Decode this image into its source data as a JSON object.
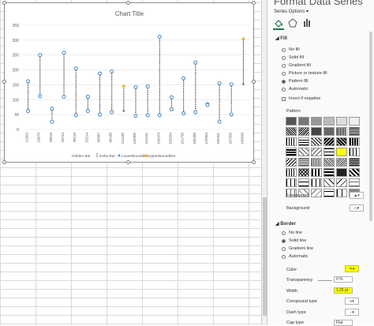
{
  "pane": {
    "title": "Format Data Series",
    "series_options_label": "Series Options",
    "fill_section": "Fill",
    "fill_options": [
      "No fill",
      "Solid fill",
      "Gradient fill",
      "Picture or texture fill",
      "Pattern fill",
      "Automatic"
    ],
    "fill_selected": 4,
    "invert_label": "Invert if negative",
    "pattern_label": "Pattern",
    "foreground_label": "Foreground",
    "background_label": "Background",
    "border_section": "Border",
    "border_options": [
      "No line",
      "Solid line",
      "Gradient line",
      "Automatic"
    ],
    "border_selected": 1,
    "color_label": "Color",
    "transparency_label": "Transparency",
    "transparency_value": "0 %",
    "width_label": "Width",
    "width_value": "1,25 pt",
    "compound_label": "Compound type",
    "dash_label": "Dash type",
    "cap_label": "Cap type",
    "cap_value": "Flat"
  },
  "colors": {
    "highlight": "#ffff00",
    "marker_blue": "#5b9bd5",
    "marker_orange": "#f4b400",
    "accent": "#1f7a4a"
  },
  "chart_data": {
    "type": "line",
    "title": "Chart Title",
    "ylim": [
      0,
      350
    ],
    "yticks": [
      0,
      50,
      100,
      150,
      200,
      250,
      300,
      350
    ],
    "categories": [
      "12963",
      "18679",
      "29010",
      "29724",
      "30210",
      "53214",
      "56587",
      "66188",
      "111440",
      "132305",
      "134111",
      "134474",
      "155334",
      "161790",
      "166288",
      "176963",
      "196201",
      "197358",
      "199698"
    ],
    "series": [
      {
        "name": "Hidden Bar",
        "values": []
      },
      {
        "name": "Delta Bar",
        "values": []
      },
      {
        "name": "LowerBoundBar",
        "values": [
          62,
          112,
          26,
          110,
          48,
          62,
          50,
          58,
          62,
          46,
          48,
          48,
          68,
          54,
          58,
          82,
          26,
          50,
          152
        ]
      },
      {
        "name": "UpperBoundBar",
        "values": [
          162,
          250,
          70,
          258,
          205,
          110,
          188,
          195,
          145,
          142,
          145,
          312,
          108,
          172,
          225,
          85,
          155,
          152,
          304
        ]
      }
    ],
    "orange_categories": [
      8,
      18
    ],
    "legend": "bottom"
  }
}
